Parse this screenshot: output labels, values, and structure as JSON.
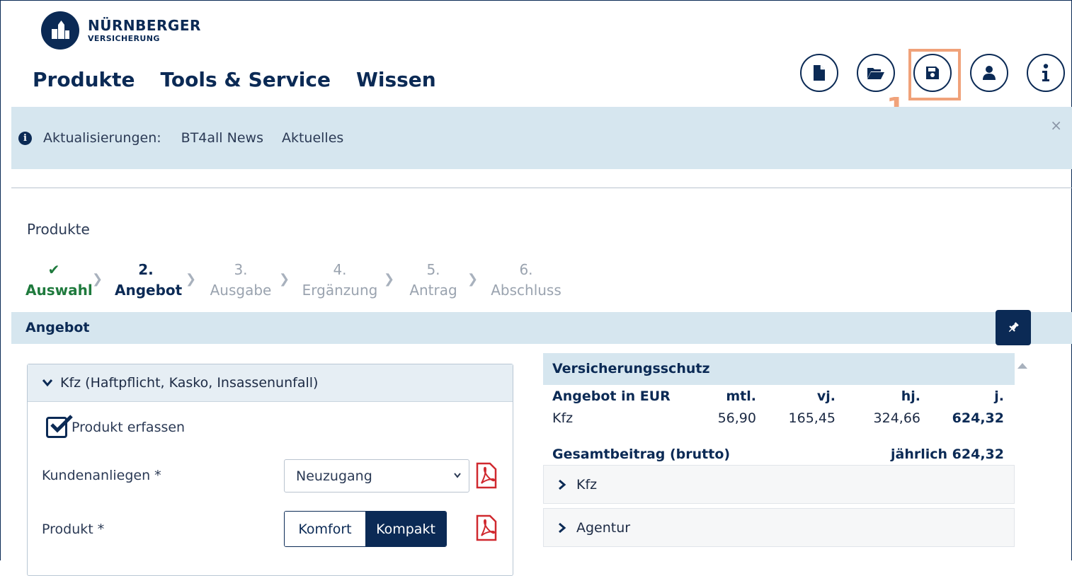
{
  "brand": {
    "name": "NÜRNBERGER",
    "sub": "VERSICHERUNG"
  },
  "mainnav": [
    "Produkte",
    "Tools & Service",
    "Wissen"
  ],
  "toolbar": {
    "icons": [
      "new-document-icon",
      "open-folder-icon",
      "save-icon",
      "user-icon",
      "info-icon"
    ],
    "highlight_number": "1"
  },
  "infobar": {
    "label": "Aktualisierungen:",
    "links": [
      "BT4all News",
      "Aktuelles"
    ],
    "close": "×"
  },
  "breadcrumb": "Produkte",
  "steps": [
    {
      "num": "✔",
      "label": "Auswahl",
      "state": "done"
    },
    {
      "num": "2.",
      "label": "Angebot",
      "state": "active"
    },
    {
      "num": "3.",
      "label": "Ausgabe",
      "state": "todo"
    },
    {
      "num": "4.",
      "label": "Ergänzung",
      "state": "todo"
    },
    {
      "num": "5.",
      "label": "Antrag",
      "state": "todo"
    },
    {
      "num": "6.",
      "label": "Abschluss",
      "state": "todo"
    }
  ],
  "section_title": "Angebot",
  "left_panel": {
    "heading": "Kfz  (Haftpflicht, Kasko, Insassenunfall)",
    "checkbox_label": "Produkt erfassen",
    "checkbox_checked": true,
    "kundenanliegen_label": "Kundenanliegen *",
    "kundenanliegen_value": "Neuzugang",
    "produkt_label": "Produkt *",
    "produkt_options": [
      "Komfort",
      "Kompakt"
    ],
    "produkt_selected": "Kompakt"
  },
  "right_panel": {
    "title": "Versicherungsschutz",
    "header": [
      "Angebot in EUR",
      "mtl.",
      "vj.",
      "hj.",
      "j."
    ],
    "row": [
      "Kfz",
      "56,90",
      "165,45",
      "324,66",
      "624,32"
    ],
    "total_label": "Gesamtbeitrag (brutto)",
    "total_value": "jährlich 624,32",
    "accordions": [
      "Kfz",
      "Agentur"
    ]
  },
  "colors": {
    "navy": "#0b2a55",
    "light_blue": "#d6e6ef",
    "done_green": "#1f7a3d",
    "highlight": "#f0a27a",
    "pdf_red": "#d0292f"
  }
}
